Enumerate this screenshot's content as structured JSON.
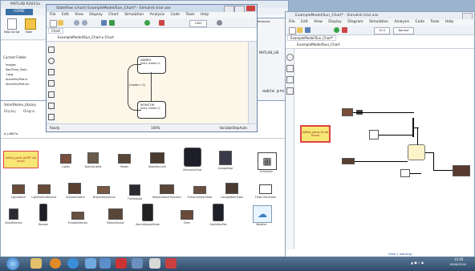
{
  "matlab": {
    "title": "MATLAB R2015a",
    "tabs": [
      "HOME",
      "PLOTS",
      "APPS"
    ],
    "ribbon_labels": [
      "New Script",
      "New"
    ],
    "current_folder_label": "Current Folder",
    "folder_items": [
      "images",
      "RealTime_Tests",
      "+pkg",
      "AlarmKeyPad.m",
      "AlarmKeyPad.slx"
    ],
    "lib_tabs": [
      "Display",
      "Diagno"
    ]
  },
  "library": {
    "header": "SmartHome_Library",
    "path": "d_LIB67a",
    "status": "View 1 warning",
    "zoom": "100%",
    "selected_block": "doSim_panel_ALERT not found",
    "row1": [
      "Lights",
      "SpecialLights",
      "Heater",
      "RobotVacuum",
      "ElementsClear",
      "GarageDoor",
      "Scheduler"
    ],
    "row2": [
      "LightSwitch",
      "LightSwitchDimmer",
      "UpDownSwitch",
      "BrightnessSensor",
      "Thermostat",
      "RobotCleanerOperator",
      "EntranceDoorState",
      "GarageDoorState",
      "Flows Generator"
    ],
    "row3": [
      "DoorDetector",
      "Remote",
      "SmokeDetector",
      "MotionSensor",
      "AlarmKeypadState",
      "Siren",
      "AlarmKeyPad",
      "Weather"
    ]
  },
  "stateflow": {
    "title": "Stateflow (chart) ExampleModel/Sun_Chart* - Simulink trial use",
    "menu": [
      "File",
      "Edit",
      "View",
      "Display",
      "Chart",
      "Simulation",
      "Analysis",
      "Code",
      "Tools",
      "Help"
    ],
    "address_tab": "Chart",
    "breadcrumb": "ExampleModel/Sun_Chart",
    "breadcrumb_child": "Chart",
    "zoom_value": "1000",
    "states": [
      {
        "name": "ARMED",
        "body": "entry: mode=1;"
      },
      {
        "name": "MONITOR",
        "body": "entry: mode=1;"
      }
    ],
    "transition": "[mode==1]",
    "status_left": "Ready",
    "status_mid": "100%",
    "status_right": "VariableStepAuto"
  },
  "simulink": {
    "title": "ExampleModel/Sun_Chart* - Simulink trial use",
    "menu": [
      "File",
      "Edit",
      "View",
      "Display",
      "Diagram",
      "Simulation",
      "Analysis",
      "Code",
      "Tools",
      "Help"
    ],
    "tab": "ExampleModel/Sun_Chart*",
    "breadcrumb": "ExampleModel/Sun_Chart",
    "sim_time": "10.0",
    "mode": "Normal",
    "error_block": "doMex_panel_M not found",
    "status": "View 1 warning"
  },
  "partial_windows": {
    "lib_title": "MATLAB_LIB",
    "partial_text": "ouble pro",
    "toolbar_labels": [
      "ferences",
      "Add-Ons",
      "mode"
    ]
  },
  "taskbar": {
    "time": "13:45",
    "date": "18/06/2016"
  },
  "colors": {
    "desktop": "#9bb3cc",
    "titlebar": "#d7e3f0",
    "canvas": "#fdf7ea",
    "error_yellow": "#f7e774",
    "error_red": "#d44",
    "taskbar": "#2f4a6a"
  }
}
